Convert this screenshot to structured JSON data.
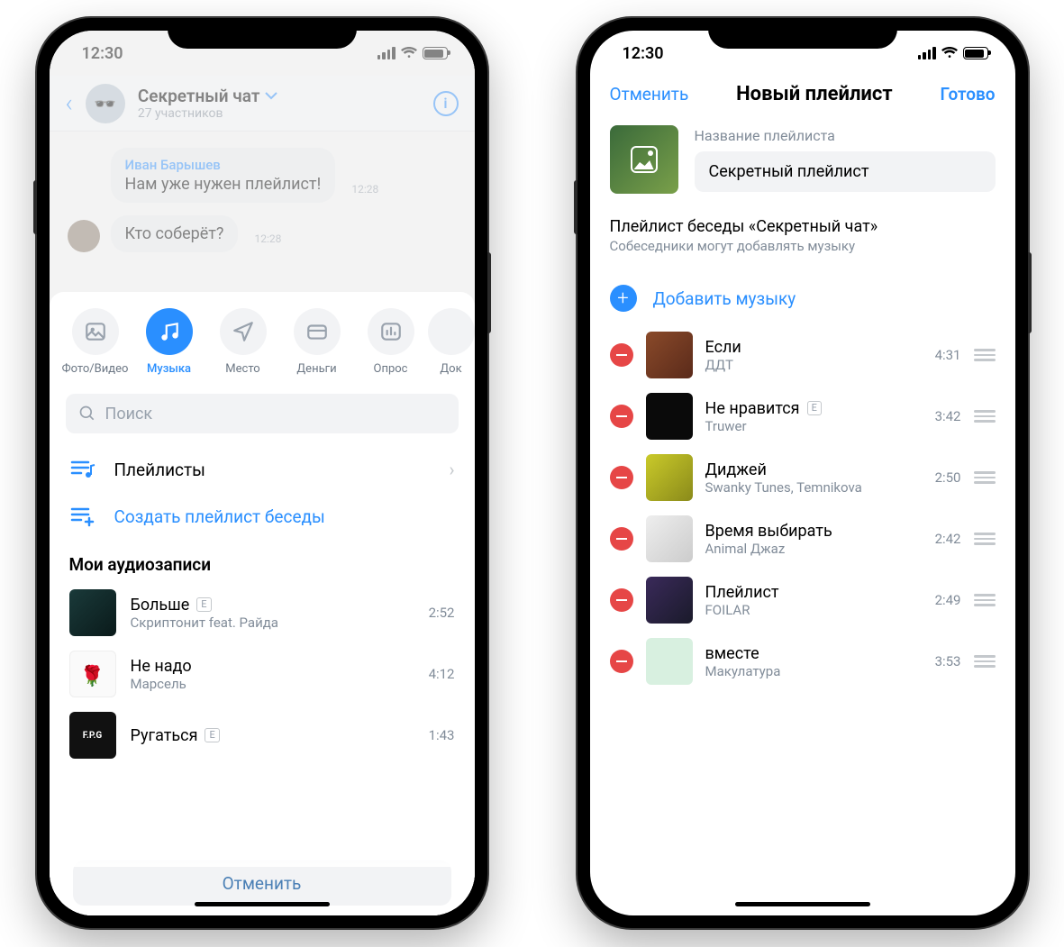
{
  "status": {
    "time": "12:30"
  },
  "left": {
    "chat": {
      "title": "Секретный чат",
      "subtitle": "27 участников",
      "messages": [
        {
          "name": "Иван Барышев",
          "text": "Нам уже нужен плейлист!",
          "time": "12:28",
          "showAvatar": false
        },
        {
          "name": "",
          "text": "Кто соберёт?",
          "time": "12:28",
          "showAvatar": true
        }
      ]
    },
    "attach": {
      "tabs": [
        {
          "id": "photo",
          "label": "Фото/Видео"
        },
        {
          "id": "music",
          "label": "Музыка",
          "active": true
        },
        {
          "id": "place",
          "label": "Место"
        },
        {
          "id": "money",
          "label": "Деньги"
        },
        {
          "id": "poll",
          "label": "Опрос"
        },
        {
          "id": "doc",
          "label": "Док"
        }
      ],
      "search_placeholder": "Поиск",
      "rows": {
        "playlists": "Плейлисты",
        "create": "Создать плейлист беседы"
      },
      "my_audio_header": "Мои аудиозаписи",
      "tracks": [
        {
          "title": "Больше",
          "artist": "Скриптонит feat. Райда",
          "dur": "2:52",
          "explicit": true,
          "cover": "#163838"
        },
        {
          "title": "Не надо",
          "artist": "Марсель",
          "dur": "4:12",
          "explicit": false,
          "cover": "#f5f5f5"
        },
        {
          "title": "Ругаться",
          "artist": "",
          "dur": "1:43",
          "explicit": true,
          "cover": "#111"
        }
      ],
      "cancel": "Отменить"
    }
  },
  "right": {
    "header": {
      "cancel": "Отменить",
      "title": "Новый плейлист",
      "done": "Готово"
    },
    "name_label": "Название плейлиста",
    "name_value": "Секретный плейлист",
    "desc_title": "Плейлист беседы «Секретный чат»",
    "desc_sub": "Собеседники могут добавлять музыку",
    "add_music": "Добавить музыку",
    "tracks": [
      {
        "title": "Если",
        "artist": "ДДТ",
        "dur": "4:31",
        "explicit": false,
        "cover": "linear-gradient(135deg,#8a4a2a,#5a2a1a)"
      },
      {
        "title": "Не нравится",
        "artist": "Truwer",
        "dur": "3:42",
        "explicit": true,
        "cover": "#0a0a0a"
      },
      {
        "title": "Диджей",
        "artist": "Swanky Tunes, Temnikova",
        "dur": "2:50",
        "explicit": false,
        "cover": "linear-gradient(135deg,#caca2a,#8a8a1a)"
      },
      {
        "title": "Время выбирать",
        "artist": "Animal Джаz",
        "dur": "2:42",
        "explicit": false,
        "cover": "linear-gradient(135deg,#eee,#ccc)"
      },
      {
        "title": "Плейлист",
        "artist": "FOILAR",
        "dur": "2:49",
        "explicit": false,
        "cover": "linear-gradient(135deg,#3a2a5a,#1a1a2a)"
      },
      {
        "title": "вместе",
        "artist": "Макулатура",
        "dur": "3:53",
        "explicit": false,
        "cover": "#d8f0e0"
      }
    ]
  }
}
